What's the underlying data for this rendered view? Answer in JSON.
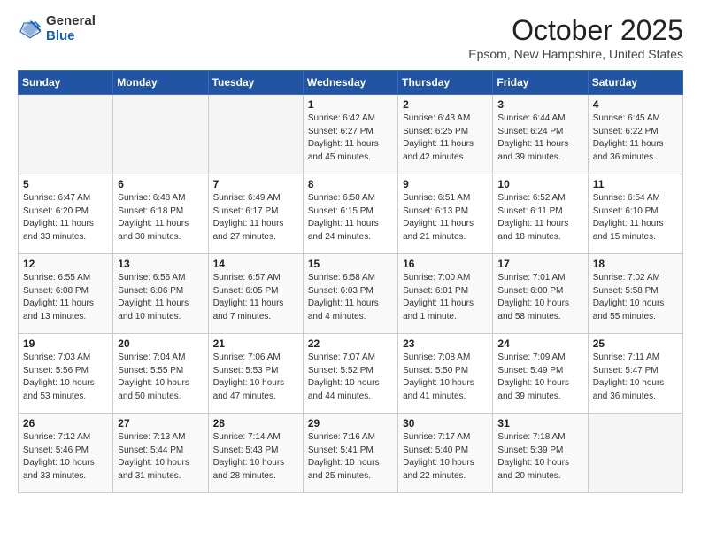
{
  "header": {
    "logo_general": "General",
    "logo_blue": "Blue",
    "title": "October 2025",
    "location": "Epsom, New Hampshire, United States"
  },
  "days_of_week": [
    "Sunday",
    "Monday",
    "Tuesday",
    "Wednesday",
    "Thursday",
    "Friday",
    "Saturday"
  ],
  "weeks": [
    [
      {
        "day": "",
        "info": ""
      },
      {
        "day": "",
        "info": ""
      },
      {
        "day": "",
        "info": ""
      },
      {
        "day": "1",
        "info": "Sunrise: 6:42 AM\nSunset: 6:27 PM\nDaylight: 11 hours\nand 45 minutes."
      },
      {
        "day": "2",
        "info": "Sunrise: 6:43 AM\nSunset: 6:25 PM\nDaylight: 11 hours\nand 42 minutes."
      },
      {
        "day": "3",
        "info": "Sunrise: 6:44 AM\nSunset: 6:24 PM\nDaylight: 11 hours\nand 39 minutes."
      },
      {
        "day": "4",
        "info": "Sunrise: 6:45 AM\nSunset: 6:22 PM\nDaylight: 11 hours\nand 36 minutes."
      }
    ],
    [
      {
        "day": "5",
        "info": "Sunrise: 6:47 AM\nSunset: 6:20 PM\nDaylight: 11 hours\nand 33 minutes."
      },
      {
        "day": "6",
        "info": "Sunrise: 6:48 AM\nSunset: 6:18 PM\nDaylight: 11 hours\nand 30 minutes."
      },
      {
        "day": "7",
        "info": "Sunrise: 6:49 AM\nSunset: 6:17 PM\nDaylight: 11 hours\nand 27 minutes."
      },
      {
        "day": "8",
        "info": "Sunrise: 6:50 AM\nSunset: 6:15 PM\nDaylight: 11 hours\nand 24 minutes."
      },
      {
        "day": "9",
        "info": "Sunrise: 6:51 AM\nSunset: 6:13 PM\nDaylight: 11 hours\nand 21 minutes."
      },
      {
        "day": "10",
        "info": "Sunrise: 6:52 AM\nSunset: 6:11 PM\nDaylight: 11 hours\nand 18 minutes."
      },
      {
        "day": "11",
        "info": "Sunrise: 6:54 AM\nSunset: 6:10 PM\nDaylight: 11 hours\nand 15 minutes."
      }
    ],
    [
      {
        "day": "12",
        "info": "Sunrise: 6:55 AM\nSunset: 6:08 PM\nDaylight: 11 hours\nand 13 minutes."
      },
      {
        "day": "13",
        "info": "Sunrise: 6:56 AM\nSunset: 6:06 PM\nDaylight: 11 hours\nand 10 minutes."
      },
      {
        "day": "14",
        "info": "Sunrise: 6:57 AM\nSunset: 6:05 PM\nDaylight: 11 hours\nand 7 minutes."
      },
      {
        "day": "15",
        "info": "Sunrise: 6:58 AM\nSunset: 6:03 PM\nDaylight: 11 hours\nand 4 minutes."
      },
      {
        "day": "16",
        "info": "Sunrise: 7:00 AM\nSunset: 6:01 PM\nDaylight: 11 hours\nand 1 minute."
      },
      {
        "day": "17",
        "info": "Sunrise: 7:01 AM\nSunset: 6:00 PM\nDaylight: 10 hours\nand 58 minutes."
      },
      {
        "day": "18",
        "info": "Sunrise: 7:02 AM\nSunset: 5:58 PM\nDaylight: 10 hours\nand 55 minutes."
      }
    ],
    [
      {
        "day": "19",
        "info": "Sunrise: 7:03 AM\nSunset: 5:56 PM\nDaylight: 10 hours\nand 53 minutes."
      },
      {
        "day": "20",
        "info": "Sunrise: 7:04 AM\nSunset: 5:55 PM\nDaylight: 10 hours\nand 50 minutes."
      },
      {
        "day": "21",
        "info": "Sunrise: 7:06 AM\nSunset: 5:53 PM\nDaylight: 10 hours\nand 47 minutes."
      },
      {
        "day": "22",
        "info": "Sunrise: 7:07 AM\nSunset: 5:52 PM\nDaylight: 10 hours\nand 44 minutes."
      },
      {
        "day": "23",
        "info": "Sunrise: 7:08 AM\nSunset: 5:50 PM\nDaylight: 10 hours\nand 41 minutes."
      },
      {
        "day": "24",
        "info": "Sunrise: 7:09 AM\nSunset: 5:49 PM\nDaylight: 10 hours\nand 39 minutes."
      },
      {
        "day": "25",
        "info": "Sunrise: 7:11 AM\nSunset: 5:47 PM\nDaylight: 10 hours\nand 36 minutes."
      }
    ],
    [
      {
        "day": "26",
        "info": "Sunrise: 7:12 AM\nSunset: 5:46 PM\nDaylight: 10 hours\nand 33 minutes."
      },
      {
        "day": "27",
        "info": "Sunrise: 7:13 AM\nSunset: 5:44 PM\nDaylight: 10 hours\nand 31 minutes."
      },
      {
        "day": "28",
        "info": "Sunrise: 7:14 AM\nSunset: 5:43 PM\nDaylight: 10 hours\nand 28 minutes."
      },
      {
        "day": "29",
        "info": "Sunrise: 7:16 AM\nSunset: 5:41 PM\nDaylight: 10 hours\nand 25 minutes."
      },
      {
        "day": "30",
        "info": "Sunrise: 7:17 AM\nSunset: 5:40 PM\nDaylight: 10 hours\nand 22 minutes."
      },
      {
        "day": "31",
        "info": "Sunrise: 7:18 AM\nSunset: 5:39 PM\nDaylight: 10 hours\nand 20 minutes."
      },
      {
        "day": "",
        "info": ""
      }
    ]
  ]
}
